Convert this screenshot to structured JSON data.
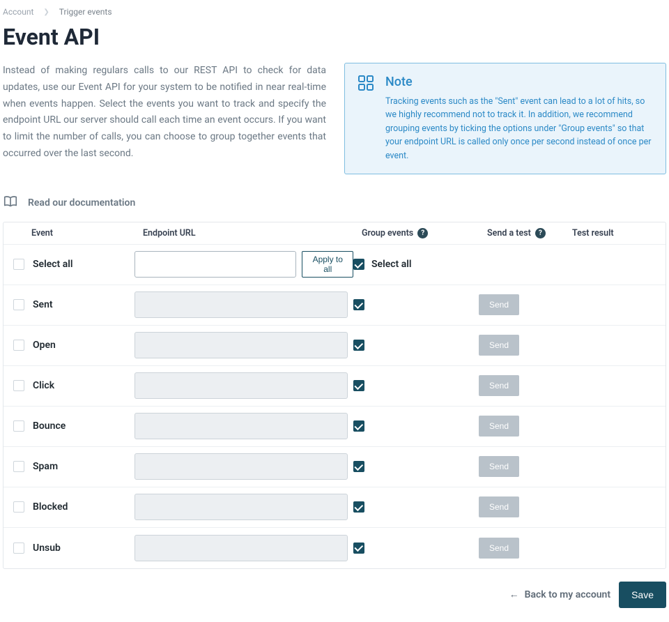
{
  "breadcrumb": {
    "account": "Account",
    "current": "Trigger events"
  },
  "title": "Event API",
  "intro": "Instead of making regulars calls to our REST API to check for data updates, use our Event API for your system to be notified in near real-time when events happen. Select the events you want to track and specify the endpoint URL our server should call each time an event occurs. If you want to limit the number of calls, you can choose to group together events that occurred over the last second.",
  "note": {
    "title": "Note",
    "body": "Tracking events such as the \"Sent\" event can lead to a lot of hits, so we highly recommend not to track it. In addition, we recommend grouping events by ticking the options under \"Group events\" so that your endpoint URL is called only once per second instead of once per event."
  },
  "doc_link": "Read our documentation",
  "columns": {
    "event": "Event",
    "url": "Endpoint URL",
    "group": "Group events",
    "test": "Send a test",
    "result": "Test result"
  },
  "select_all_row": {
    "label": "Select all",
    "event_checked": false,
    "apply_label": "Apply to all",
    "group_label": "Select all",
    "group_checked": true
  },
  "rows": [
    {
      "label": "Sent",
      "event_checked": false,
      "group_checked": true,
      "send_label": "Send"
    },
    {
      "label": "Open",
      "event_checked": false,
      "group_checked": true,
      "send_label": "Send"
    },
    {
      "label": "Click",
      "event_checked": false,
      "group_checked": true,
      "send_label": "Send"
    },
    {
      "label": "Bounce",
      "event_checked": false,
      "group_checked": true,
      "send_label": "Send"
    },
    {
      "label": "Spam",
      "event_checked": false,
      "group_checked": true,
      "send_label": "Send"
    },
    {
      "label": "Blocked",
      "event_checked": false,
      "group_checked": true,
      "send_label": "Send"
    },
    {
      "label": "Unsub",
      "event_checked": false,
      "group_checked": true,
      "send_label": "Send"
    }
  ],
  "footer": {
    "back": "Back to my account",
    "save": "Save"
  }
}
